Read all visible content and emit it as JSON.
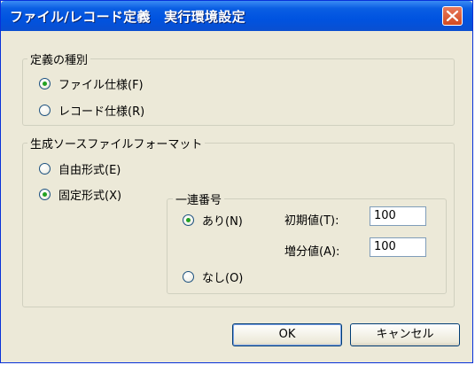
{
  "window": {
    "title": "ファイル/レコード定義　実行環境設定"
  },
  "definition_type": {
    "legend": "定義の種別",
    "options": [
      {
        "label": "ファイル仕様(F)",
        "selected": true
      },
      {
        "label": "レコード仕様(R)",
        "selected": false
      }
    ]
  },
  "source_format": {
    "legend": "生成ソースファイルフォーマット",
    "options": [
      {
        "label": "自由形式(E)",
        "selected": false
      },
      {
        "label": "固定形式(X)",
        "selected": true
      }
    ],
    "sequence": {
      "legend": "一連番号",
      "options": [
        {
          "label": "あり(N)",
          "selected": true
        },
        {
          "label": "なし(O)",
          "selected": false
        }
      ],
      "initial_label": "初期値(T):",
      "initial_value": "100",
      "increment_label": "増分値(A):",
      "increment_value": "100"
    }
  },
  "buttons": {
    "ok": "OK",
    "cancel": "キャンセル"
  }
}
